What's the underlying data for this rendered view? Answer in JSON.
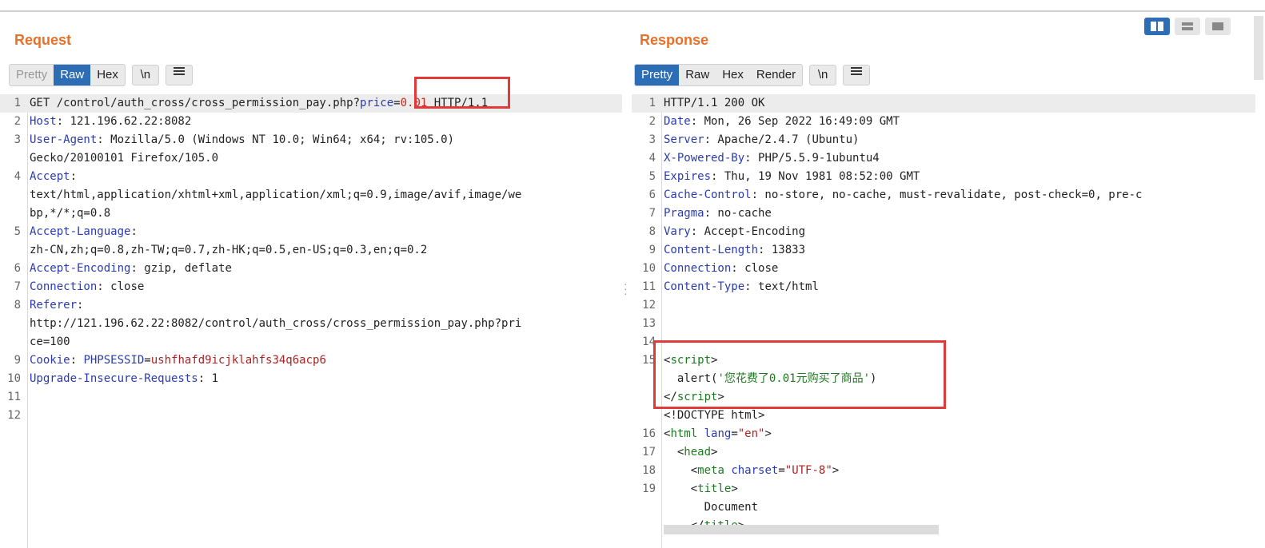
{
  "request": {
    "title": "Request",
    "tabs": [
      "Pretty",
      "Raw",
      "Hex"
    ],
    "active_tab": "Raw",
    "newline_btn": "\\n",
    "menu_icon": "hamburger-icon",
    "lines": [
      {
        "n": "1",
        "parts": [
          [
            "GET /control/auth_cross/cross_permission_pay.php",
            "hv"
          ],
          [
            "?",
            "hv"
          ],
          [
            "price",
            "pk"
          ],
          [
            "=",
            "hv"
          ],
          [
            "0.01",
            "pv"
          ],
          [
            " HTTP/1.1",
            "hv"
          ]
        ],
        "hl": true
      },
      {
        "n": "2",
        "parts": [
          [
            "Host",
            "hk"
          ],
          [
            ": 121.196.62.22:8082",
            "hv"
          ]
        ]
      },
      {
        "n": "3",
        "parts": [
          [
            "User-Agent",
            "hk"
          ],
          [
            ": Mozilla/5.0 (Windows NT 10.0; Win64; x64; rv:105.0)",
            "hv"
          ]
        ]
      },
      {
        "n": "",
        "parts": [
          [
            "Gecko/20100101 Firefox/105.0",
            "hv"
          ]
        ]
      },
      {
        "n": "4",
        "parts": [
          [
            "Accept",
            "hk"
          ],
          [
            ":",
            "hv"
          ]
        ]
      },
      {
        "n": "",
        "parts": [
          [
            "text/html,application/xhtml+xml,application/xml;q=0.9,image/avif,image/we",
            "hv"
          ]
        ]
      },
      {
        "n": "",
        "parts": [
          [
            "bp,*/*;q=0.8",
            "hv"
          ]
        ]
      },
      {
        "n": "5",
        "parts": [
          [
            "Accept-Language",
            "hk"
          ],
          [
            ":",
            "hv"
          ]
        ]
      },
      {
        "n": "",
        "parts": [
          [
            "zh-CN,zh;q=0.8,zh-TW;q=0.7,zh-HK;q=0.5,en-US;q=0.3,en;q=0.2",
            "hv"
          ]
        ]
      },
      {
        "n": "6",
        "parts": [
          [
            "Accept-Encoding",
            "hk"
          ],
          [
            ": gzip, deflate",
            "hv"
          ]
        ]
      },
      {
        "n": "7",
        "parts": [
          [
            "Connection",
            "hk"
          ],
          [
            ": close",
            "hv"
          ]
        ]
      },
      {
        "n": "8",
        "parts": [
          [
            "Referer",
            "hk"
          ],
          [
            ":",
            "hv"
          ]
        ]
      },
      {
        "n": "",
        "parts": [
          [
            "http://121.196.62.22:8082/control/auth_cross/cross_permission_pay.php?pri",
            "hv"
          ]
        ]
      },
      {
        "n": "",
        "parts": [
          [
            "ce=100",
            "hv"
          ]
        ]
      },
      {
        "n": "9",
        "parts": [
          [
            "Cookie",
            "hk"
          ],
          [
            ": ",
            "hv"
          ],
          [
            "PHPSESSID",
            "ck"
          ],
          [
            "=",
            "hv"
          ],
          [
            "ushfhafd9icjklahfs34q6acp6",
            "cv"
          ]
        ]
      },
      {
        "n": "10",
        "parts": [
          [
            "Upgrade-Insecure-Requests",
            "hk"
          ],
          [
            ": 1",
            "hv"
          ]
        ]
      },
      {
        "n": "11",
        "parts": []
      },
      {
        "n": "12",
        "parts": []
      }
    ]
  },
  "response": {
    "title": "Response",
    "tabs": [
      "Pretty",
      "Raw",
      "Hex",
      "Render"
    ],
    "active_tab": "Pretty",
    "newline_btn": "\\n",
    "menu_icon": "hamburger-icon",
    "lines": [
      {
        "n": "1",
        "parts": [
          [
            "HTTP/1.1 200 OK",
            "hv"
          ]
        ],
        "hl": true
      },
      {
        "n": "2",
        "parts": [
          [
            "Date",
            "hk"
          ],
          [
            ": Mon, 26 Sep 2022 16:49:09 GMT",
            "hv"
          ]
        ]
      },
      {
        "n": "3",
        "parts": [
          [
            "Server",
            "hk"
          ],
          [
            ": Apache/2.4.7 (Ubuntu)",
            "hv"
          ]
        ]
      },
      {
        "n": "4",
        "parts": [
          [
            "X-Powered-By",
            "hk"
          ],
          [
            ": PHP/5.5.9-1ubuntu4",
            "hv"
          ]
        ]
      },
      {
        "n": "5",
        "parts": [
          [
            "Expires",
            "hk"
          ],
          [
            ": Thu, 19 Nov 1981 08:52:00 GMT",
            "hv"
          ]
        ]
      },
      {
        "n": "6",
        "parts": [
          [
            "Cache-Control",
            "hk"
          ],
          [
            ": no-store, no-cache, must-revalidate, post-check=0, pre-c",
            "hv"
          ]
        ]
      },
      {
        "n": "7",
        "parts": [
          [
            "Pragma",
            "hk"
          ],
          [
            ": no-cache",
            "hv"
          ]
        ]
      },
      {
        "n": "8",
        "parts": [
          [
            "Vary",
            "hk"
          ],
          [
            ": Accept-Encoding",
            "hv"
          ]
        ]
      },
      {
        "n": "9",
        "parts": [
          [
            "Content-Length",
            "hk"
          ],
          [
            ": 13833",
            "hv"
          ]
        ]
      },
      {
        "n": "10",
        "parts": [
          [
            "Connection",
            "hk"
          ],
          [
            ": close",
            "hv"
          ]
        ]
      },
      {
        "n": "11",
        "parts": [
          [
            "Content-Type",
            "hk"
          ],
          [
            ": text/html",
            "hv"
          ]
        ]
      },
      {
        "n": "12",
        "parts": []
      },
      {
        "n": "13",
        "parts": []
      },
      {
        "n": "14",
        "parts": []
      },
      {
        "n": "15",
        "parts": [
          [
            "<",
            "hv"
          ],
          [
            "script",
            "tg"
          ],
          [
            ">",
            "hv"
          ]
        ]
      },
      {
        "n": "",
        "parts": [
          [
            "  alert(",
            "hv"
          ],
          [
            "'您花费了0.01元购买了商品'",
            "st"
          ],
          [
            ")",
            "hv"
          ]
        ]
      },
      {
        "n": "",
        "parts": [
          [
            "</",
            "hv"
          ],
          [
            "script",
            "tg"
          ],
          [
            ">",
            "hv"
          ]
        ]
      },
      {
        "n": "",
        "parts": [
          [
            "<!DOCTYPE html>",
            "hv"
          ]
        ]
      },
      {
        "n": "16",
        "parts": [
          [
            "<",
            "hv"
          ],
          [
            "html",
            "tg"
          ],
          [
            " ",
            "hv"
          ],
          [
            "lang",
            "at"
          ],
          [
            "=",
            "hv"
          ],
          [
            "\"en\"",
            "av"
          ],
          [
            ">",
            "hv"
          ]
        ]
      },
      {
        "n": "17",
        "parts": [
          [
            "  <",
            "hv"
          ],
          [
            "head",
            "tg"
          ],
          [
            ">",
            "hv"
          ]
        ]
      },
      {
        "n": "18",
        "parts": [
          [
            "    <",
            "hv"
          ],
          [
            "meta",
            "tg"
          ],
          [
            " ",
            "hv"
          ],
          [
            "charset",
            "at"
          ],
          [
            "=",
            "hv"
          ],
          [
            "\"UTF-8\"",
            "av"
          ],
          [
            ">",
            "hv"
          ]
        ]
      },
      {
        "n": "19",
        "parts": [
          [
            "    <",
            "hv"
          ],
          [
            "title",
            "tg"
          ],
          [
            ">",
            "hv"
          ]
        ]
      },
      {
        "n": "",
        "parts": [
          [
            "      Document",
            "hv"
          ]
        ]
      },
      {
        "n": "",
        "parts": [
          [
            "    </",
            "hv"
          ],
          [
            "title",
            "tg"
          ],
          [
            ">",
            "hv"
          ]
        ]
      }
    ]
  },
  "layout_toggle": {
    "options": [
      "split-columns-icon",
      "split-rows-icon",
      "single-pane-icon"
    ],
    "active": "split-columns-icon"
  },
  "colors": {
    "accent": "#2d6db5",
    "title": "#e8702a",
    "highlight_box": "#e03a3a"
  }
}
